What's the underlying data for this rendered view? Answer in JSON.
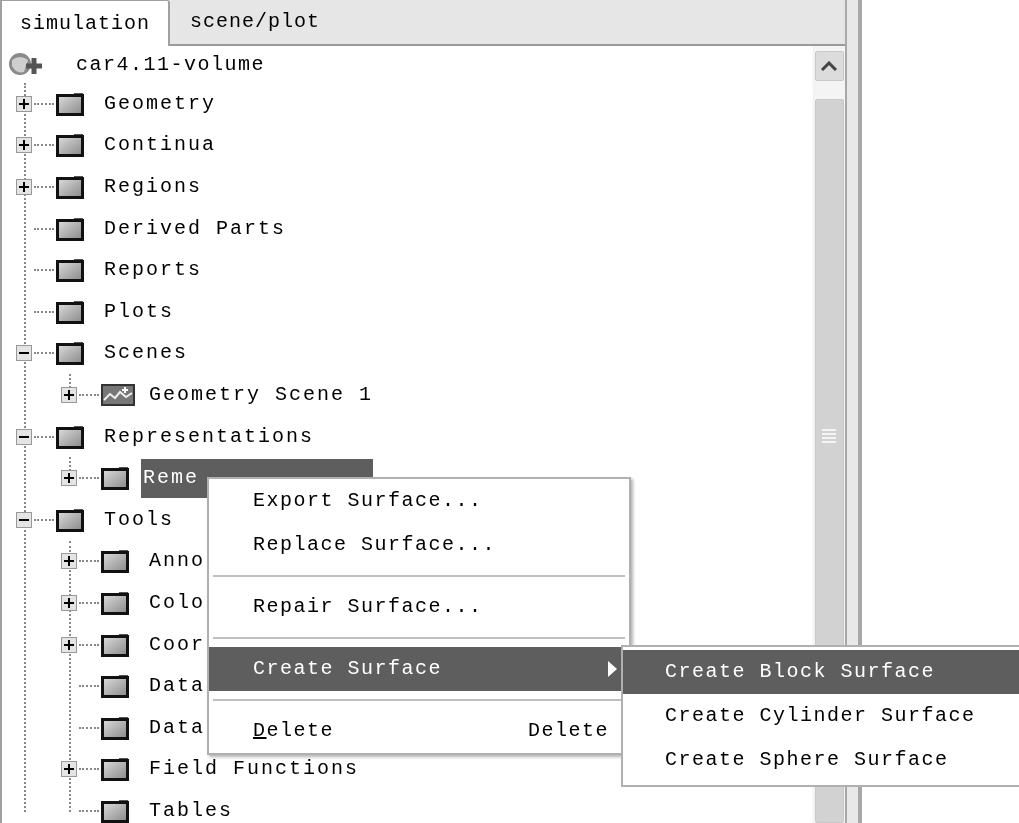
{
  "tabs": [
    {
      "label": "simulation",
      "selected": true
    },
    {
      "label": "scene/plot",
      "selected": false
    }
  ],
  "tree": {
    "label": "car4.11-volume",
    "kind": "simulation",
    "children": [
      {
        "label": "Geometry",
        "kind": "folder",
        "expandable": true,
        "expanded": false,
        "selected": false
      },
      {
        "label": "Continua",
        "kind": "folder",
        "expandable": true,
        "expanded": false,
        "selected": false
      },
      {
        "label": "Regions",
        "kind": "folder",
        "expandable": true,
        "expanded": false,
        "selected": false
      },
      {
        "label": "Derived Parts",
        "kind": "folder",
        "expandable": false,
        "expanded": false,
        "selected": false
      },
      {
        "label": "Reports",
        "kind": "folder",
        "expandable": false,
        "expanded": false,
        "selected": false
      },
      {
        "label": "Plots",
        "kind": "folder",
        "expandable": false,
        "expanded": false,
        "selected": false
      },
      {
        "label": "Scenes",
        "kind": "folder",
        "expandable": true,
        "expanded": true,
        "selected": false,
        "children": [
          {
            "label": "Geometry Scene 1",
            "kind": "scene",
            "expandable": true,
            "expanded": false,
            "selected": false
          }
        ]
      },
      {
        "label": "Representations",
        "kind": "folder",
        "expandable": true,
        "expanded": true,
        "selected": false,
        "children": [
          {
            "label": "Reme",
            "kind": "folder",
            "expandable": true,
            "expanded": false,
            "selected": true
          }
        ]
      },
      {
        "label": "Tools",
        "kind": "folder",
        "expandable": true,
        "expanded": true,
        "selected": false,
        "children": [
          {
            "label": "Anno",
            "kind": "folder",
            "expandable": true,
            "expanded": false,
            "selected": false
          },
          {
            "label": "Colo",
            "kind": "folder",
            "expandable": true,
            "expanded": false,
            "selected": false
          },
          {
            "label": "Coor",
            "kind": "folder",
            "expandable": true,
            "expanded": false,
            "selected": false
          },
          {
            "label": "Data",
            "kind": "folder",
            "expandable": false,
            "expanded": false,
            "selected": false
          },
          {
            "label": "Data",
            "kind": "folder",
            "expandable": false,
            "expanded": false,
            "selected": false
          },
          {
            "label": "Field Functions",
            "kind": "folder",
            "expandable": true,
            "expanded": false,
            "selected": false
          },
          {
            "label": "Tables",
            "kind": "folder",
            "expandable": false,
            "expanded": false,
            "selected": false
          }
        ]
      }
    ]
  },
  "context_menu": [
    {
      "kind": "item",
      "label": "Export Surface...",
      "selected": false,
      "mnemonic": false
    },
    {
      "kind": "item",
      "label": "Replace Surface...",
      "selected": false,
      "mnemonic": false
    },
    {
      "kind": "separator"
    },
    {
      "kind": "item",
      "label": "Repair Surface...",
      "selected": false,
      "mnemonic": false
    },
    {
      "kind": "separator"
    },
    {
      "kind": "submenu",
      "label": "Create Surface",
      "selected": true,
      "mnemonic": false
    },
    {
      "kind": "separator"
    },
    {
      "kind": "item",
      "label": "Delete",
      "shortcut": "Delete",
      "selected": false,
      "mnemonic": true
    }
  ],
  "submenu": [
    {
      "label": "Create Block Surface",
      "selected": true
    },
    {
      "label": "Create Cylinder Surface",
      "selected": false
    },
    {
      "label": "Create Sphere Surface",
      "selected": false
    }
  ]
}
